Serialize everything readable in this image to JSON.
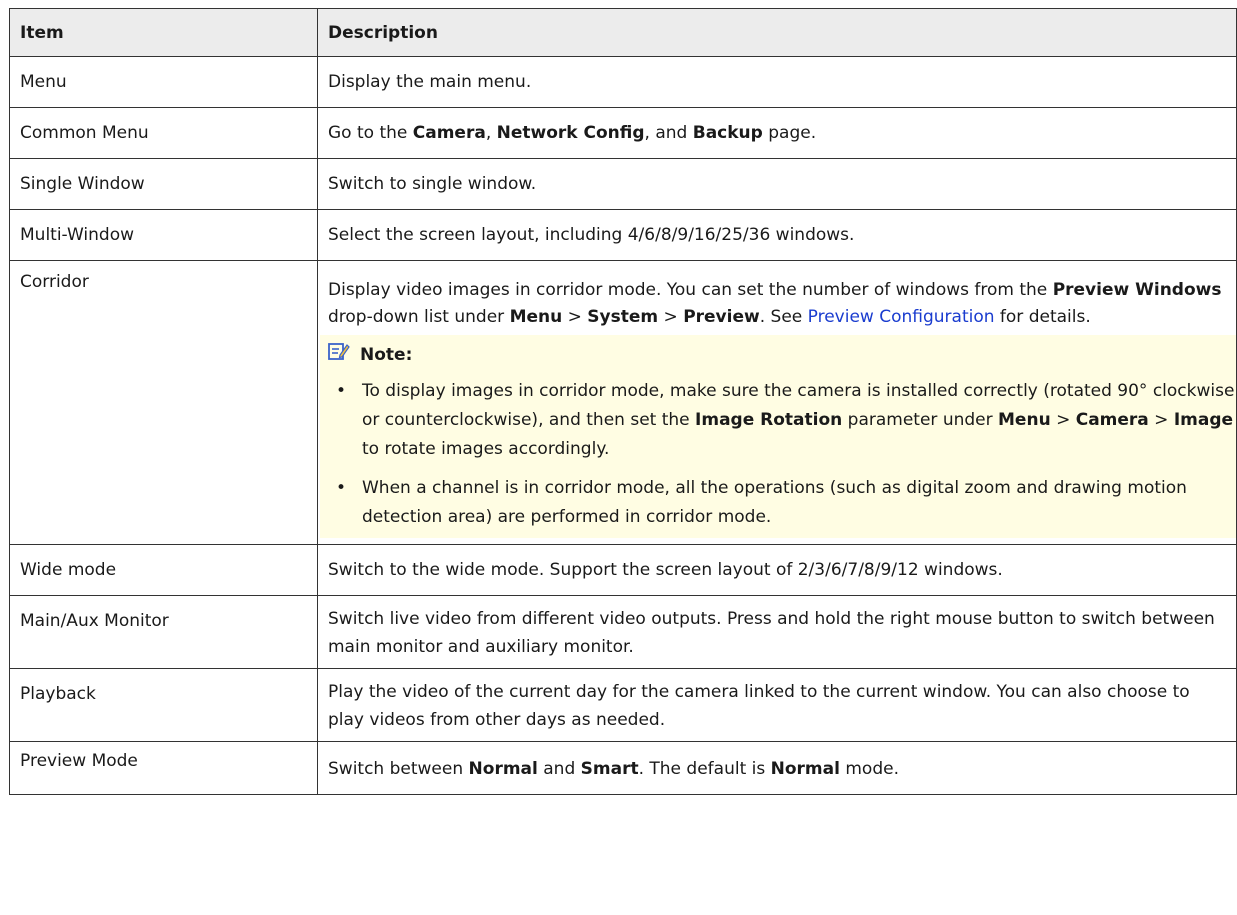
{
  "table": {
    "headers": [
      "Item",
      "Description"
    ],
    "rows": {
      "menu": {
        "item": "Menu",
        "desc": "Display the main menu."
      },
      "common_menu": {
        "item": "Common Menu",
        "desc": {
          "t1": "Go to the ",
          "b1": "Camera",
          "t2": ", ",
          "b2": "Network Config",
          "t3": ", and ",
          "b3": "Backup",
          "t4": " page."
        }
      },
      "single_window": {
        "item": "Single Window",
        "desc": "Switch to single window."
      },
      "multi_window": {
        "item": "Multi-Window",
        "desc": "Select the screen layout, including 4/6/8/9/16/25/36 windows."
      },
      "corridor": {
        "item": "Corridor",
        "desc": {
          "t1": "Display video images in corridor mode. You can set the number of windows from the ",
          "b1": "Preview Windows",
          "t2": " drop-down list under ",
          "b2": "Menu",
          "t3": " > ",
          "b3": "System",
          "t4": " > ",
          "b4": "Preview",
          "t5": ". See ",
          "link": "Preview Configuration",
          "t6": " for details."
        },
        "note": {
          "title": "Note:",
          "bullet1": {
            "t1": "To display images in corridor mode, make sure the camera is installed correctly (rotated 90° clockwise or counterclockwise), and then set the ",
            "b1": "Image Rotation",
            "t2": " parameter under ",
            "b2": "Menu",
            "t3": " > ",
            "b3": "Camera",
            "t4": " > ",
            "b4": "Image",
            "t5": " to rotate images accordingly."
          },
          "bullet2": "When a channel is in corridor mode, all the operations (such as digital zoom and drawing motion detection area) are performed in corridor mode."
        }
      },
      "wide_mode": {
        "item": "Wide mode",
        "desc": "Switch to the wide mode. Support the screen layout of 2/3/6/7/8/9/12 windows."
      },
      "main_aux": {
        "item": "Main/Aux Monitor",
        "desc": "Switch live video from different video outputs. Press and hold the right mouse button to switch between main monitor and auxiliary monitor."
      },
      "playback": {
        "item": "Playback",
        "desc": "Play the video of the current day for the camera linked to the current window. You can also choose to play videos from other days as needed."
      },
      "preview_mode": {
        "item": "Preview Mode",
        "desc": {
          "t1": "Switch between ",
          "b1": "Normal",
          "t2": " and ",
          "b2": "Smart",
          "t3": ". The default is ",
          "b3": "Normal",
          "t4": " mode."
        }
      }
    }
  },
  "icons": {
    "note": "note-pencil-icon"
  },
  "colors": {
    "link": "#1a3ccf",
    "note_bg": "#fffde3",
    "header_bg": "#ececec",
    "note_icon": "#3b63c9"
  }
}
